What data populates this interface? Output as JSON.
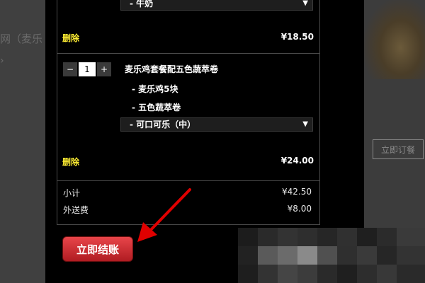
{
  "background": {
    "left_text": "网（麦乐",
    "left_chevron": "›",
    "order_button": "立即订餐"
  },
  "cart": {
    "item1": {
      "option": "- 牛奶",
      "delete": "删除",
      "price": "¥18.50"
    },
    "item2": {
      "quantity": "1",
      "minus": "−",
      "plus": "+",
      "title": "麦乐鸡套餐配五色蔬萃卷",
      "subitems": [
        "- 麦乐鸡5块",
        "- 五色蔬萃卷"
      ],
      "drink": "- 可口可乐（中）",
      "delete": "删除",
      "price": "¥24.00"
    },
    "summary": {
      "subtotal_label": "小计",
      "subtotal_value": "¥42.50",
      "delivery_label": "外送费",
      "delivery_value": "¥8.00"
    },
    "checkout_label": "立即结账"
  },
  "colors": {
    "delete": "#ffee33",
    "checkout": "#c8282e",
    "arrow": "#e00000"
  }
}
